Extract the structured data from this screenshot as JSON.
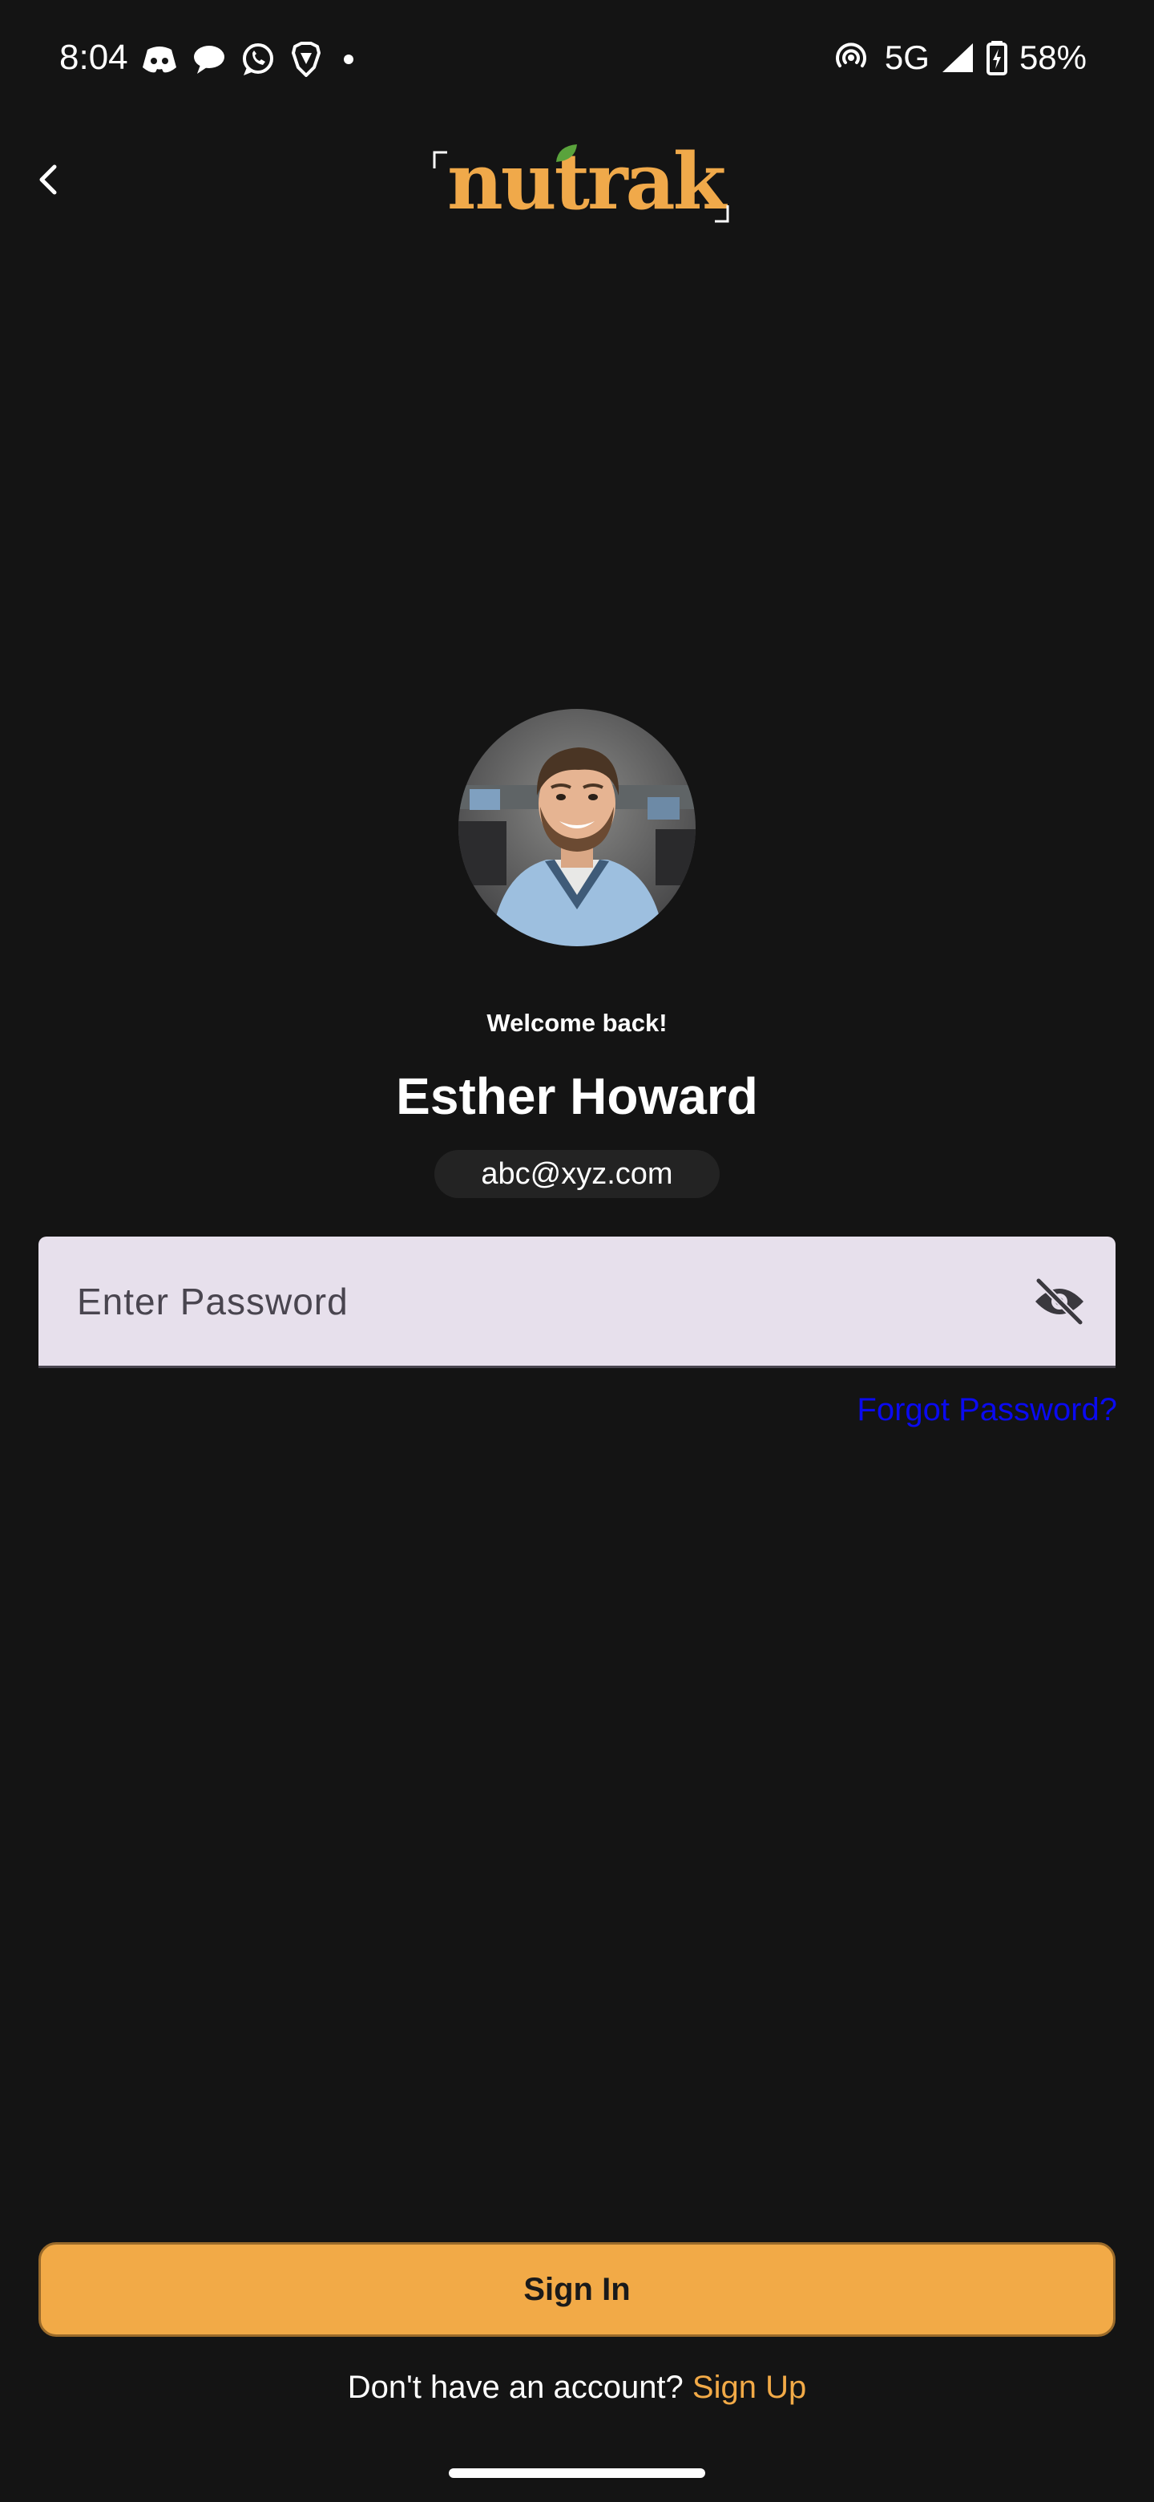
{
  "status_bar": {
    "time": "8:04",
    "network": "5G",
    "battery": "58%",
    "left_icons": [
      "discord-icon",
      "chat-bubble-icon",
      "whatsapp-icon",
      "brave-icon",
      "notification-dot-icon"
    ],
    "right_icons": [
      "hotspot-icon",
      "signal-icon",
      "battery-charging-icon"
    ]
  },
  "header": {
    "back_icon": "chevron-left-icon",
    "logo_text": "nutrak"
  },
  "profile": {
    "welcome": "Welcome back!",
    "name": "Esther Howard",
    "email": "abc@xyz.com"
  },
  "password": {
    "placeholder": "Enter Password",
    "value": "",
    "toggle_icon": "eye-off-icon"
  },
  "forgot_password": "Forgot Password?",
  "sign_in": "Sign In",
  "signup": {
    "prompt": "Don't have an account?",
    "link": "Sign Up"
  },
  "colors": {
    "background": "#141414",
    "accent": "#f2aa47",
    "logo": "#f0a94a",
    "logo_leaf": "#5aa33c",
    "field_background": "#e7e0ec",
    "link": "#0a0af0"
  }
}
